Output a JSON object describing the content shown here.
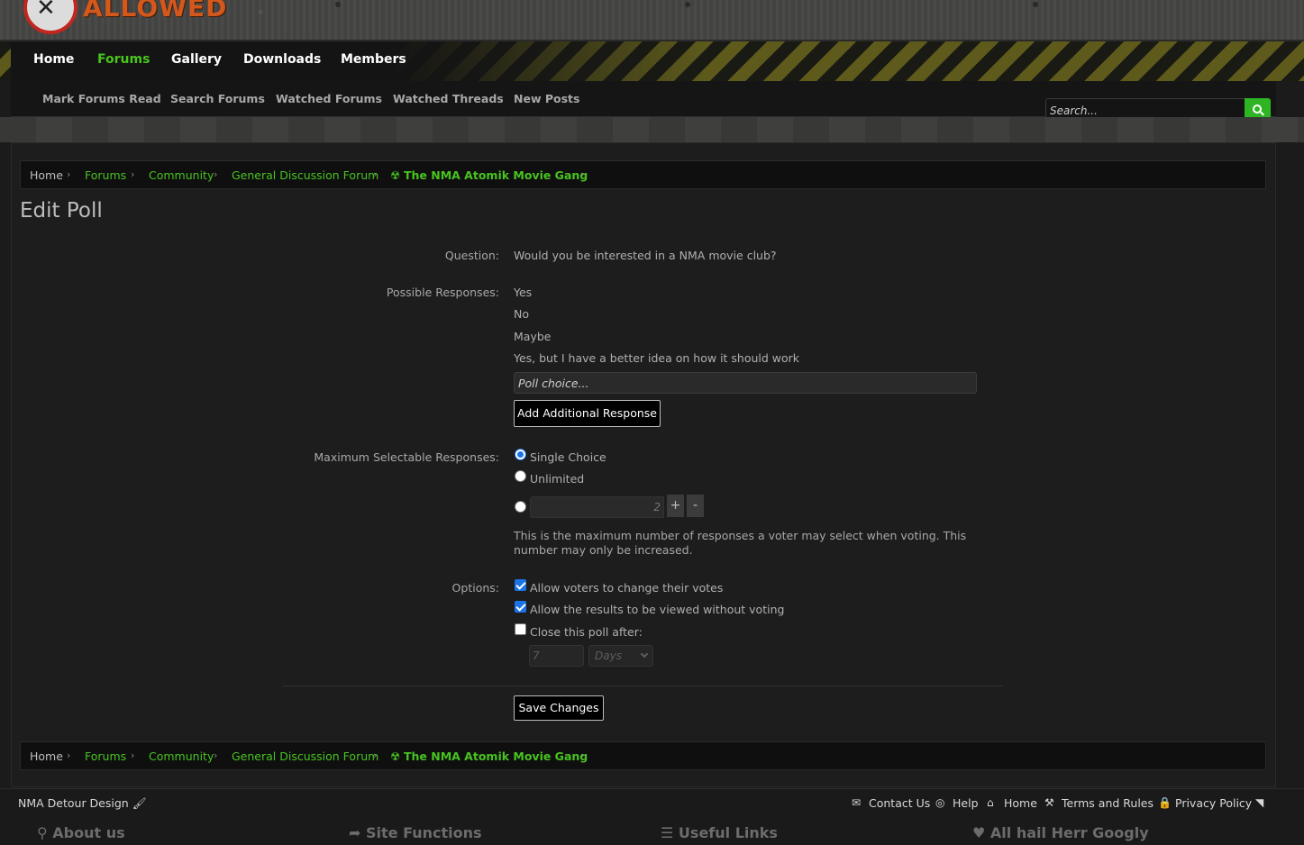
{
  "site": {
    "logo_text": "ALLOWED"
  },
  "nav": {
    "items": [
      "Home",
      "Forums",
      "Gallery",
      "Downloads",
      "Members"
    ],
    "active": "Forums"
  },
  "subnav": {
    "items": [
      "Mark Forums Read",
      "Search Forums",
      "Watched Forums",
      "Watched Threads",
      "New Posts"
    ]
  },
  "search": {
    "placeholder": "Search..."
  },
  "breadcrumb": {
    "items": [
      "Home",
      "Forums",
      "Community",
      "General Discussion Forum",
      "The NMA Atomik Movie Gang"
    ]
  },
  "page": {
    "title": "Edit Poll"
  },
  "form": {
    "question_label": "Question:",
    "question_value": "Would you be interested in a NMA movie club?",
    "responses_label": "Possible Responses:",
    "responses": [
      "Yes",
      "No",
      "Maybe",
      "Yes, but I have a better idea on how it should work"
    ],
    "poll_choice_placeholder": "Poll choice...",
    "add_response_label": "Add Additional Response",
    "max_label": "Maximum Selectable Responses:",
    "max_options": [
      "Single Choice",
      "Unlimited"
    ],
    "max_selected": "Single Choice",
    "max_number_value": "2",
    "stepper_plus": "+",
    "stepper_minus": "-",
    "max_hint": "This is the maximum number of responses a voter may select when voting. This number may only be increased.",
    "options_label": "Options:",
    "options": [
      {
        "label": "Allow voters to change their votes",
        "checked": true
      },
      {
        "label": "Allow the results to be viewed without voting",
        "checked": true
      },
      {
        "label": "Close this poll after:",
        "checked": false
      }
    ],
    "close_after_value": "7",
    "close_after_unit": "Days",
    "save_label": "Save Changes"
  },
  "footer": {
    "style_name": "NMA Detour Design",
    "links": [
      "Contact Us",
      "Help",
      "Home",
      "Terms and Rules",
      "Privacy Policy"
    ],
    "columns": [
      "About us",
      "Site Functions",
      "Useful Links",
      "All hail Herr Googly"
    ]
  },
  "colors": {
    "accent": "#48c41f",
    "search_button": "#2fb523",
    "background": "#1b1b1b"
  }
}
